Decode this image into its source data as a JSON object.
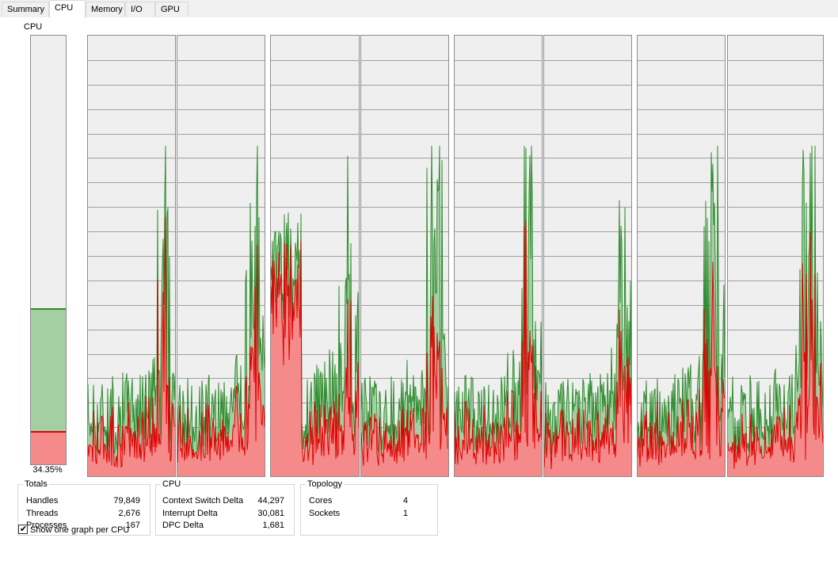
{
  "tabs": [
    "Summary",
    "CPU",
    "Memory",
    "I/O",
    "GPU"
  ],
  "active_tab": "CPU",
  "cpu_meter": {
    "label": "CPU",
    "percent_text": "34.35%",
    "total_fraction": 0.361,
    "kernel_fraction": 0.074
  },
  "colors": {
    "total": "#2e8b2e",
    "total_fill": "#a3cfa3",
    "kernel": "#e00000",
    "kernel_fill": "#f58a8a",
    "grid": "#a0a0a0",
    "background": "#efefef"
  },
  "cpu_graphs_count": 8,
  "totals": {
    "title": "Totals",
    "rows": [
      {
        "label": "Handles",
        "value": "79,849"
      },
      {
        "label": "Threads",
        "value": "2,676"
      },
      {
        "label": "Processes",
        "value": "167"
      }
    ]
  },
  "cpu_stats": {
    "title": "CPU",
    "rows": [
      {
        "label": "Context Switch Delta",
        "value": "44,297"
      },
      {
        "label": "Interrupt Delta",
        "value": "30,081"
      },
      {
        "label": "DPC Delta",
        "value": "1,681"
      }
    ]
  },
  "topology": {
    "title": "Topology",
    "rows": [
      {
        "label": "Cores",
        "value": "4"
      },
      {
        "label": "Sockets",
        "value": "1"
      }
    ]
  },
  "checkbox": {
    "label": "Show one graph per CPU",
    "checked": true
  }
}
